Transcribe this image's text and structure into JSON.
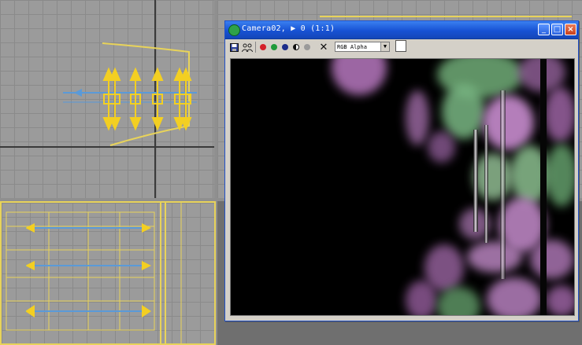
{
  "render_window": {
    "title": "Camera02, ▶ 0 (1:1)",
    "buttons": {
      "minimize": "_",
      "maximize": "□",
      "close": "×"
    },
    "toolbar": {
      "channel_selected": "RGB Alpha",
      "channel_arrow": "▼",
      "clear_symbol": "✕",
      "icons": [
        "save-icon",
        "clone-icon",
        "red-channel-icon",
        "green-channel-icon",
        "blue-channel-icon",
        "alpha-channel-icon",
        "mono-icon",
        "clear-icon",
        "color-swatch"
      ]
    }
  },
  "colors": {
    "titlebar": "#1752d4",
    "viewport_bg": "#9b9b9b",
    "selection": "#e8d35a",
    "render_purple": "#b070b8",
    "render_green": "#78b880"
  }
}
